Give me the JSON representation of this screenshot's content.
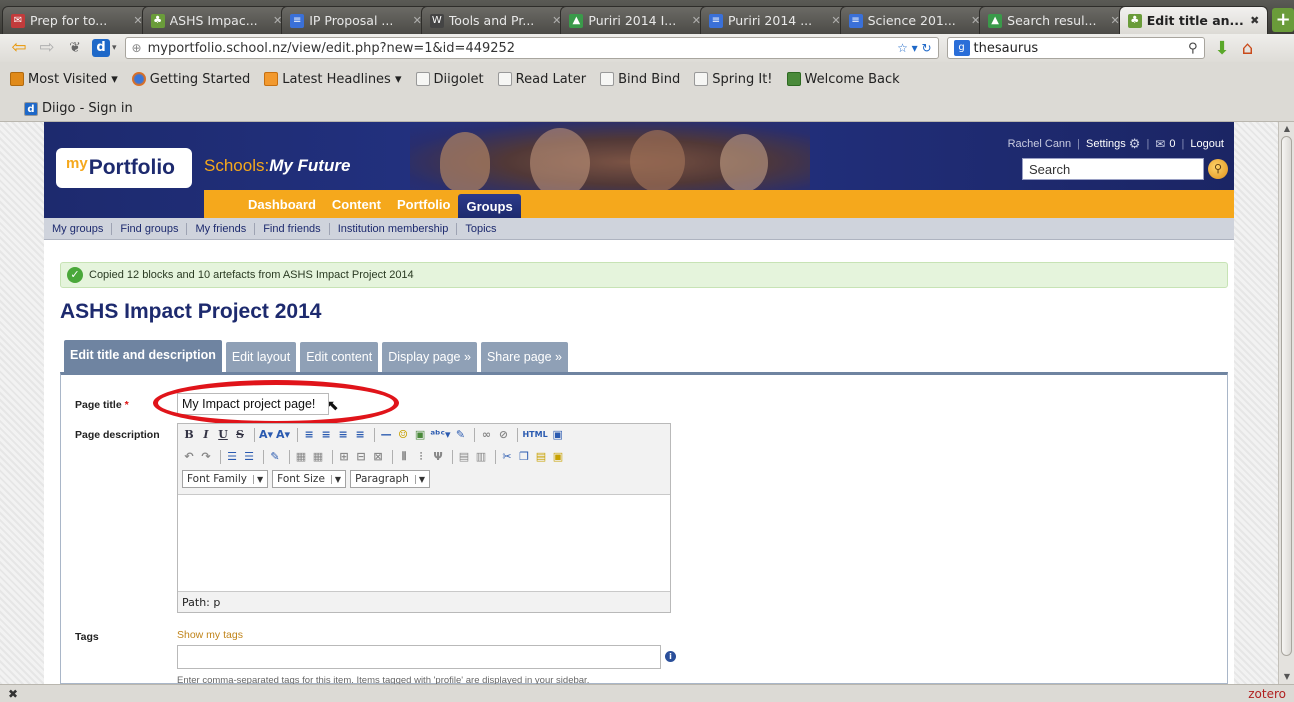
{
  "browser": {
    "tabs": [
      {
        "title": "Prep for to...",
        "icon": "mail-icon",
        "color": "#c23b3b",
        "active": false
      },
      {
        "title": "ASHS Impac...",
        "icon": "plant-icon",
        "color": "#6a9c3a",
        "active": false
      },
      {
        "title": "IP Proposal ...",
        "icon": "doc-icon",
        "color": "#3a70d8",
        "active": false
      },
      {
        "title": "Tools and Pr...",
        "icon": "we-icon",
        "color": "#444444",
        "active": false
      },
      {
        "title": "Puriri 2014 I...",
        "icon": "drive-icon",
        "color": "#3a9a4a",
        "active": false
      },
      {
        "title": "Puriri 2014 ...",
        "icon": "doc-icon",
        "color": "#3a70d8",
        "active": false
      },
      {
        "title": "Science 201...",
        "icon": "doc-icon",
        "color": "#3a70d8",
        "active": false
      },
      {
        "title": "Search resul...",
        "icon": "drive-icon",
        "color": "#3a9a4a",
        "active": false
      },
      {
        "title": "Edit title an...",
        "icon": "plant-icon",
        "color": "#6a9c3a",
        "active": true
      }
    ],
    "url": "myportfolio.school.nz/view/edit.php?new=1&id=449252",
    "search_value": "thesaurus",
    "bookmarks": [
      {
        "label": "Most Visited ▾",
        "icon": "mv"
      },
      {
        "label": "Getting Started",
        "icon": "ff"
      },
      {
        "label": "Latest Headlines ▾",
        "icon": "rss"
      },
      {
        "label": "Diigolet",
        "icon": "page"
      },
      {
        "label": "Read Later",
        "icon": "page"
      },
      {
        "label": "Bind Bind",
        "icon": "page"
      },
      {
        "label": "Spring It!",
        "icon": "page"
      },
      {
        "label": "Welcome Back",
        "icon": "wb"
      }
    ],
    "bookmark2": "Diigo - Sign in",
    "status_right": "zotero"
  },
  "site": {
    "logo": {
      "my": "my",
      "name": "Portfolio"
    },
    "tagline": {
      "prefix": "Schools:",
      "suffix": "My Future"
    },
    "user": {
      "name": "Rachel Cann",
      "settings": "Settings",
      "count": "0",
      "logout": "Logout"
    },
    "search_placeholder": "Search",
    "mainnav": [
      "Dashboard",
      "Content",
      "Portfolio",
      "Groups"
    ],
    "subnav": [
      "My groups",
      "Find groups",
      "My friends",
      "Find friends",
      "Institution membership",
      "Topics"
    ],
    "alert": "Copied 12 blocks and 10 artefacts from ASHS Impact Project 2014",
    "page_title": "ASHS Impact Project 2014",
    "edit_tabs": [
      "Edit title and description",
      "Edit layout",
      "Edit content",
      "Display page »",
      "Share page »"
    ],
    "form": {
      "title_label": "Page title",
      "title_value": "My Impact project page!",
      "desc_label": "Page description",
      "font_family": "Font Family",
      "font_size": "Font Size",
      "paragraph": "Paragraph",
      "path": "Path: p",
      "tags_label": "Tags",
      "show_tags": "Show my tags",
      "tags_hint": "Enter comma-separated tags for this item. Items tagged with 'profile' are displayed in your sidebar."
    }
  },
  "colors": {
    "navy": "#1d2a6e",
    "orange": "#f5a81c",
    "highlight": "#e0141a"
  }
}
